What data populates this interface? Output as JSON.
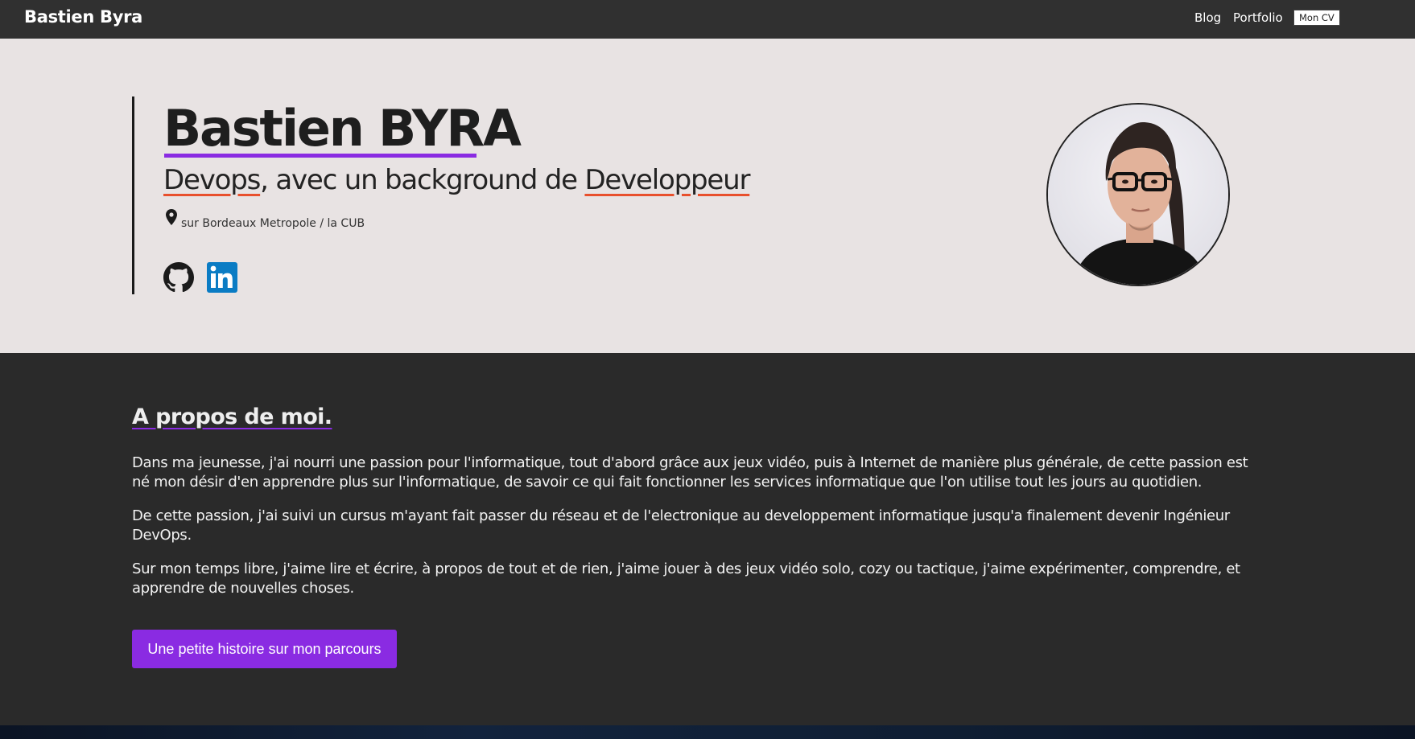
{
  "header": {
    "brand": "Bastien Byra",
    "nav": {
      "blog": "Blog",
      "portfolio": "Portfolio",
      "cv": "Mon CV"
    }
  },
  "hero": {
    "name": "Bastien BYRA",
    "subtitle": {
      "word1": "Devops",
      "middle": ", avec un background de ",
      "word2": "Developpeur"
    },
    "location": "sur Bordeaux Metropole / la CUB",
    "social": [
      "github-icon",
      "linkedin-icon"
    ]
  },
  "about": {
    "title": "A propos de moi.",
    "paragraphs": [
      "Dans ma jeunesse, j'ai nourri une passion pour l'informatique, tout d'abord grâce aux jeux vidéo, puis à Internet de manière plus générale, de cette passion est né mon désir d'en apprendre plus sur l'informatique, de savoir ce qui fait fonctionner les services informatique que l'on utilise tout les jours au quotidien.",
      "De cette passion, j'ai suivi un cursus m'ayant fait passer du réseau et de l'electronique au developpement informatique jusqu'a finalement devenir Ingénieur DevOps.",
      "Sur mon temps libre, j'aime lire et écrire, à propos de tout et de rien, j'aime jouer à des jeux vidéo solo, cozy ou tactique, j'aime expérimenter, comprendre, et apprendre de nouvelles choses."
    ],
    "cta": "Une petite histoire sur mon parcours"
  },
  "colors": {
    "accent": "#8a2be2",
    "underline": "#e8502d",
    "header_bg": "#303030",
    "hero_bg": "#e8e3e3",
    "about_bg": "#2a2a2a"
  }
}
